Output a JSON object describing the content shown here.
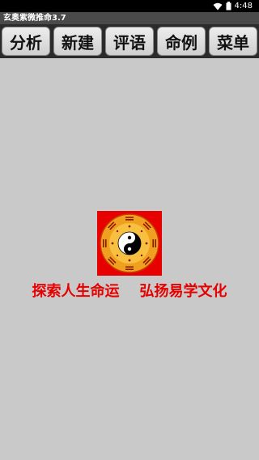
{
  "status_bar": {
    "time": "4:48",
    "icons": [
      "wifi-icon",
      "battery-icon"
    ]
  },
  "app": {
    "title": "玄奥紫微推命3.7"
  },
  "toolbar": {
    "buttons": [
      {
        "label": "分析"
      },
      {
        "label": "新建"
      },
      {
        "label": "评语"
      },
      {
        "label": "命例"
      },
      {
        "label": "菜单"
      }
    ]
  },
  "splash": {
    "logo_icon": "bagua-yinyang-icon",
    "slogan": "探索人生命运    弘扬易学文化"
  },
  "colors": {
    "background": "#c9c9c9",
    "slogan": "#e60000",
    "logo_background": "#e60000",
    "logo_ring": "#f0a020"
  }
}
